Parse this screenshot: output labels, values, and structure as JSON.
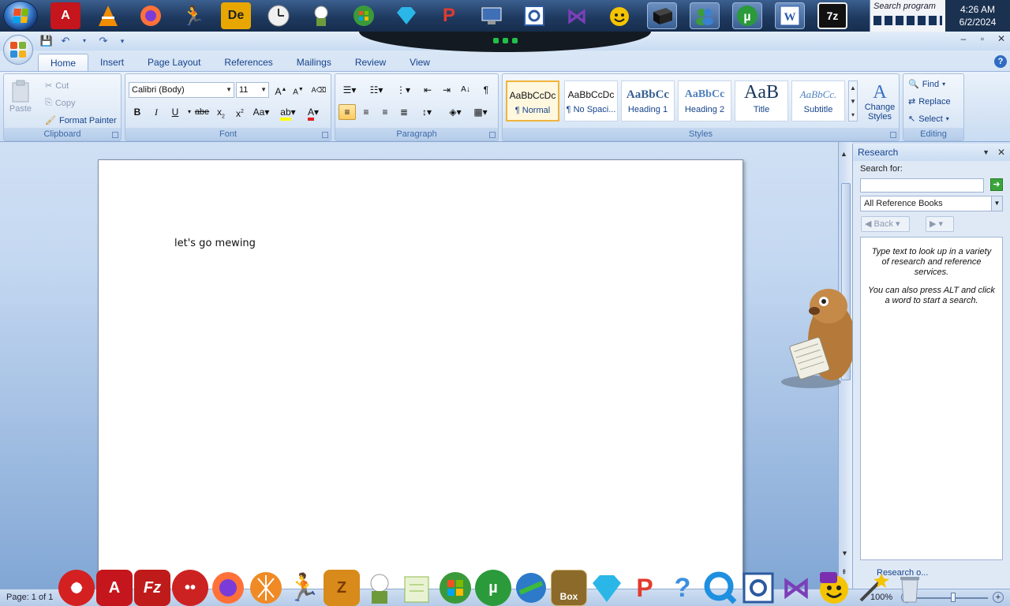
{
  "taskbar": {
    "search_placeholder": "Search program",
    "clock_time": "4:26 AM",
    "clock_date": "6/2/2024",
    "icons": [
      {
        "name": "start-orb",
        "color": "#2f6cc3"
      },
      {
        "name": "adobe-acrobat-icon",
        "color": "#c4161c"
      },
      {
        "name": "vlc-icon",
        "color": "#f28c00"
      },
      {
        "name": "firefox-icon",
        "color": "#ff7139"
      },
      {
        "name": "aim-icon",
        "color": "#f5c400"
      },
      {
        "name": "dreamweaver-icon",
        "color": "#e7a600"
      },
      {
        "name": "clock-icon",
        "color": "#dcdcdc"
      },
      {
        "name": "plant-icon",
        "color": "#6e9a3c"
      },
      {
        "name": "windows-icon",
        "color": "#3a9a3a"
      },
      {
        "name": "diamond-icon",
        "color": "#2bb6e8"
      },
      {
        "name": "p-app-icon",
        "color": "#e23b2f"
      },
      {
        "name": "remote-desktop-icon",
        "color": "#3f6fb5"
      },
      {
        "name": "gear-box-icon",
        "color": "#2c5aa0"
      },
      {
        "name": "visual-studio-icon",
        "color": "#7b3fb8"
      },
      {
        "name": "yahoo-messenger-icon",
        "color": "#f5c400"
      },
      {
        "name": "black-box-icon",
        "color": "#222222"
      },
      {
        "name": "msn-icon",
        "color": "#3c9c3c"
      },
      {
        "name": "utorrent-icon",
        "color": "#2a9a3a"
      },
      {
        "name": "word-icon",
        "color": "#2b5aa8"
      },
      {
        "name": "7zip-icon",
        "color": "#111111"
      }
    ]
  },
  "word": {
    "quick_access": [
      "save-icon",
      "undo-icon",
      "redo-icon",
      "customize-icon"
    ],
    "tabs": [
      "Home",
      "Insert",
      "Page Layout",
      "References",
      "Mailings",
      "Review",
      "View"
    ],
    "active_tab": "Home",
    "clipboard": {
      "paste": "Paste",
      "cut": "Cut",
      "copy": "Copy",
      "format_painter": "Format Painter",
      "label": "Clipboard"
    },
    "font": {
      "font_name": "Calibri (Body)",
      "font_size": "11",
      "label": "Font"
    },
    "paragraph": {
      "label": "Paragraph"
    },
    "styles": {
      "label": "Styles",
      "items": [
        {
          "sample": "AaBbCcDc",
          "name": "¶ Normal"
        },
        {
          "sample": "AaBbCcDc",
          "name": "¶ No Spaci..."
        },
        {
          "sample": "AaBbCc",
          "name": "Heading 1"
        },
        {
          "sample": "AaBbCc",
          "name": "Heading 2"
        },
        {
          "sample": "AaB",
          "name": "Title"
        },
        {
          "sample": "AaBbCc.",
          "name": "Subtitle"
        }
      ],
      "change_styles": "Change Styles"
    },
    "editing": {
      "find": "Find",
      "replace": "Replace",
      "select": "Select",
      "label": "Editing"
    },
    "document": {
      "text": "let's go mewing"
    },
    "research": {
      "title": "Research",
      "search_for": "Search for:",
      "search_value": "",
      "reference_source": "All Reference Books",
      "back": "Back",
      "results_line1": "Type text to look up in a variety of research and reference services.",
      "results_line2": "You can also press ALT and click a word to start a search.",
      "options_link": "Research o..."
    },
    "status": {
      "page_info": "Page: 1 of 1",
      "zoom": "100%"
    }
  },
  "dock": {
    "icons": [
      {
        "name": "red-app-icon",
        "color": "#d42020"
      },
      {
        "name": "adobe-acrobat-icon",
        "color": "#c4161c"
      },
      {
        "name": "filezilla-icon",
        "color": "#bf1b1b"
      },
      {
        "name": "red-ball-icon",
        "color": "#cc2222"
      },
      {
        "name": "firefox-icon",
        "color": "#ff7139"
      },
      {
        "name": "orange-disc-icon",
        "color": "#f08a24"
      },
      {
        "name": "aim-icon",
        "color": "#f5c400"
      },
      {
        "name": "z-app-icon",
        "color": "#d88a1a"
      },
      {
        "name": "plant-icon",
        "color": "#6e9a3c"
      },
      {
        "name": "notepad-icon",
        "color": "#8fb84a"
      },
      {
        "name": "windows-icon",
        "color": "#3a9a3a"
      },
      {
        "name": "utorrent-icon",
        "color": "#2a9a3a"
      },
      {
        "name": "internet-download-icon",
        "color": "#2c7ac9"
      },
      {
        "name": "gopher-box-icon",
        "color": "#8c6a2a"
      },
      {
        "name": "diamond-icon",
        "color": "#2bb6e8"
      },
      {
        "name": "p-app-icon",
        "color": "#e23b2f"
      },
      {
        "name": "help-icon",
        "color": "#3c8fe0"
      },
      {
        "name": "quicktime-icon",
        "color": "#1f8fe0"
      },
      {
        "name": "gear-box-icon",
        "color": "#2c5aa0"
      },
      {
        "name": "visual-studio-icon",
        "color": "#7b3fb8"
      },
      {
        "name": "yahoo-messenger-icon",
        "color": "#7b2fb0"
      },
      {
        "name": "wand-icon",
        "color": "#444444"
      },
      {
        "name": "recycle-bin-icon",
        "color": "#b7c4d4"
      }
    ],
    "dock_labels": {
      "box": "Box"
    }
  }
}
